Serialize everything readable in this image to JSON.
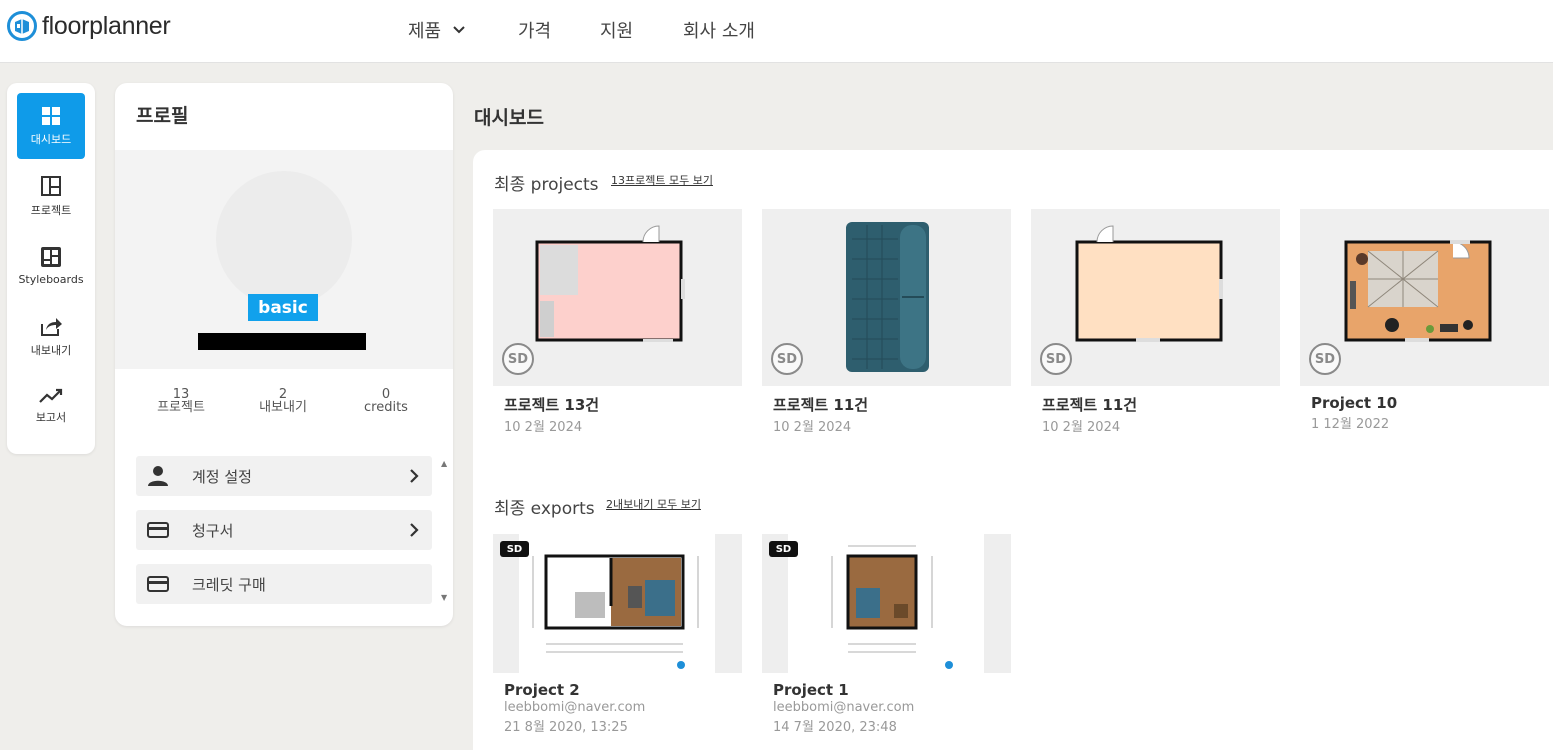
{
  "brand": {
    "name": "floorplanner",
    "accent": "#0f9be9"
  },
  "topnav": {
    "products": "제품",
    "pricing": "가격",
    "support": "지원",
    "about": "회사 소개"
  },
  "rail": {
    "dashboard": "대시보드",
    "projects": "프로젝트",
    "styleboards": "Styleboards",
    "exports": "내보내기",
    "reports": "보고서"
  },
  "profile": {
    "title": "프로필",
    "plan": "basic",
    "stats": [
      {
        "value": "13",
        "label": "프로젝트"
      },
      {
        "value": "2",
        "label": "내보내기"
      },
      {
        "value": "0",
        "label": "credits"
      }
    ],
    "menu": {
      "account": "계정 설정",
      "billing": "청구서",
      "buy_credits": "크레딧 구매"
    }
  },
  "dashboard": {
    "title": "대시보드",
    "recent_projects": {
      "title": "최종 projects",
      "link": "13프로젝트 모두 보기",
      "items": [
        {
          "title": "프로젝트 13건",
          "date": "10 2월 2024",
          "badge": "SD"
        },
        {
          "title": "프로젝트 11건",
          "date": "10 2월 2024",
          "badge": "SD"
        },
        {
          "title": "프로젝트 11건",
          "date": "10 2월 2024",
          "badge": "SD"
        },
        {
          "title": "Project 10",
          "date": "1 12월 2022",
          "badge": "SD"
        }
      ]
    },
    "recent_exports": {
      "title": "최종 exports",
      "link": "2내보내기 모두 보기",
      "items": [
        {
          "title": "Project 2",
          "email": "leebbomi@naver.com",
          "date": "21 8월 2020, 13:25",
          "badge": "SD"
        },
        {
          "title": "Project 1",
          "email": "leebbomi@naver.com",
          "date": "14 7월 2020, 23:48",
          "badge": "SD"
        }
      ]
    }
  }
}
